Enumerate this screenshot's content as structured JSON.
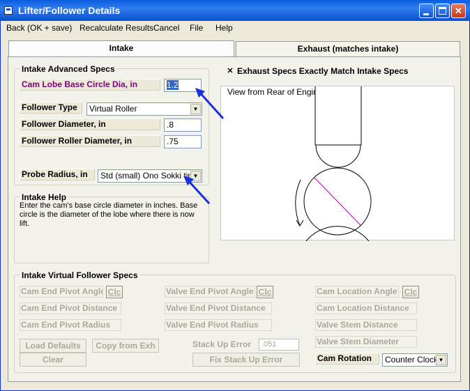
{
  "window": {
    "title": "Lifter/Follower Details"
  },
  "menu": [
    "Back (OK + save)",
    "Recalculate Results",
    "Cancel",
    "File",
    "Help"
  ],
  "tabs": {
    "intake": "Intake",
    "exhaust": "Exhaust (matches intake)"
  },
  "advanced_specs": {
    "title": "Intake Advanced Specs",
    "cam_lobe_base_circle_label": "Cam Lobe Base Circle Dia, in",
    "cam_lobe_base_circle_value": "1.2",
    "follower_type_label": "Follower Type",
    "follower_type_value": "Virtual Roller",
    "follower_diameter_label": "Follower Diameter, in",
    "follower_diameter_value": ".8",
    "follower_roller_diameter_label": "Follower Roller Diameter, in",
    "follower_roller_diameter_value": ".75",
    "probe_radius_label": "Probe Radius, in",
    "probe_radius_value": "Std (small) Ono Sokki tip"
  },
  "help": {
    "title": "Intake Help",
    "text": "Enter the cam's base circle diameter in inches.  Base circle is the diameter of the lobe where there is now lift."
  },
  "exhaust_match": {
    "label": "Exhaust Specs Exactly Match Intake Specs",
    "checked": true
  },
  "view": {
    "label": "View from Rear of Engine"
  },
  "virtual_specs": {
    "title": "Intake Virtual Follower Specs",
    "cam_end_pivot_angle": "Cam End Pivot Angle",
    "cam_end_pivot_distance": "Cam End Pivot Distance",
    "cam_end_pivot_radius": "Cam End Pivot Radius",
    "valve_end_pivot_angle": "Valve End Pivot Angle",
    "valve_end_pivot_distance": "Valve End Pivot Distance",
    "valve_end_pivot_radius": "Valve End Pivot Radius",
    "cam_location_angle": "Cam Location Angle",
    "cam_location_distance": "Cam Location Distance",
    "valve_stem_distance": "Valve Stem Distance",
    "valve_stem_diameter": "Valve Stem Diameter",
    "clc": "Clc",
    "load_defaults": "Load Defaults",
    "copy_from_exh": "Copy from Exh",
    "clear": "Clear",
    "stack_up_error_label": "Stack Up Error",
    "stack_up_error_value": ".051",
    "fix_stack_up_error": "Fix Stack Up Error",
    "cam_rotation_label": "Cam Rotation",
    "cam_rotation_value": "Counter Clockw"
  },
  "colors": {
    "highlight_label": "#800080",
    "arrow": "#1a2fd8",
    "selection": "#316ac5"
  }
}
